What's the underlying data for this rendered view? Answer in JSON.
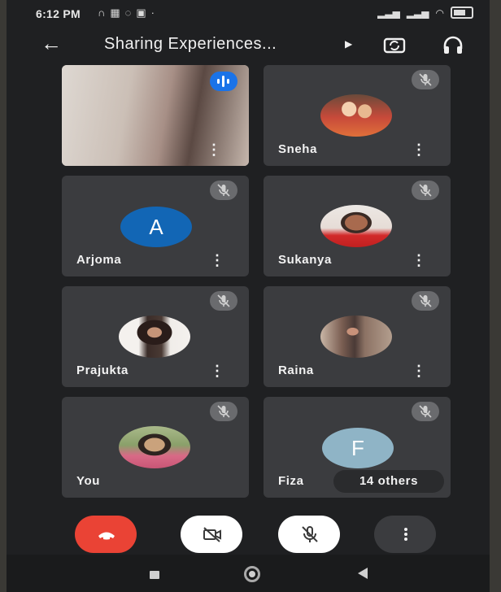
{
  "status_bar": {
    "time": "6:12 PM",
    "left_icons": [
      "headset-icon",
      "gallery-icon",
      "message-icon",
      "app-icon"
    ],
    "right_icons": [
      "signal-icon",
      "signal-icon",
      "wifi-icon",
      "battery-icon"
    ]
  },
  "top_bar": {
    "title": "Sharing Experiences...",
    "icons": [
      "back-arrow-icon",
      "title-expand-icon",
      "switch-camera-icon",
      "headphones-icon"
    ]
  },
  "participants": [
    {
      "name": "",
      "type": "video",
      "speaking": true
    },
    {
      "name": "Sneha",
      "type": "photo",
      "muted": true
    },
    {
      "name": "Arjoma",
      "type": "letter",
      "letter": "A",
      "avatar_color": "#1266b5",
      "muted": true
    },
    {
      "name": "Sukanya",
      "type": "photo",
      "muted": true
    },
    {
      "name": "Prajukta",
      "type": "photo",
      "muted": true
    },
    {
      "name": "Raina",
      "type": "photo",
      "muted": true
    },
    {
      "name": "You",
      "type": "photo",
      "muted": true
    },
    {
      "name": "Fiza",
      "type": "letter",
      "letter": "F",
      "avatar_color": "#8fb4c6",
      "muted": true
    }
  ],
  "others_pill": "14 others",
  "controls": {
    "end_call_color": "#ea4335",
    "icons": [
      "end-call-icon",
      "camera-off-icon",
      "mic-off-icon",
      "more-options-icon"
    ]
  },
  "colors": {
    "background": "#1f2022",
    "tile": "#3b3c3f",
    "speaking_indicator": "#1a73e8"
  }
}
